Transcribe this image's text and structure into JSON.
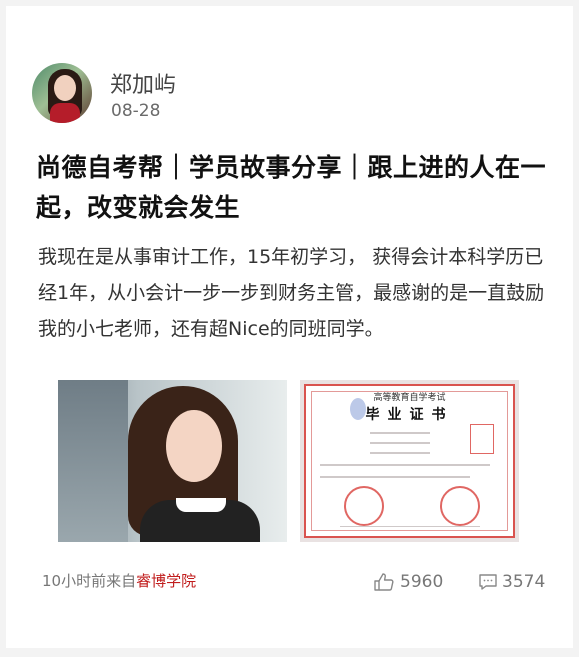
{
  "author": {
    "name": "郑加屿",
    "date": "08-28"
  },
  "post": {
    "title": "尚德自考帮｜学员故事分享｜跟上进的人在一起，改变就会发生",
    "body": "我现在是从事审计工作，15年初学习， 获得会计本科学历已经1年，从小会计一步一步到财务主管，最感谢的是一直鼓励我的小七老师，还有超Nice的同班同学。",
    "certificate": {
      "heading": "高等教育自学考试",
      "title": "毕业证书"
    }
  },
  "footer": {
    "time_prefix": "10小时前来自",
    "source": "睿博学院",
    "likes": "5960",
    "comments": "3574"
  },
  "icons": {
    "like": "thumbs-up-icon",
    "comment": "comment-bubble-icon"
  },
  "colors": {
    "source_link": "#c11d1d"
  }
}
